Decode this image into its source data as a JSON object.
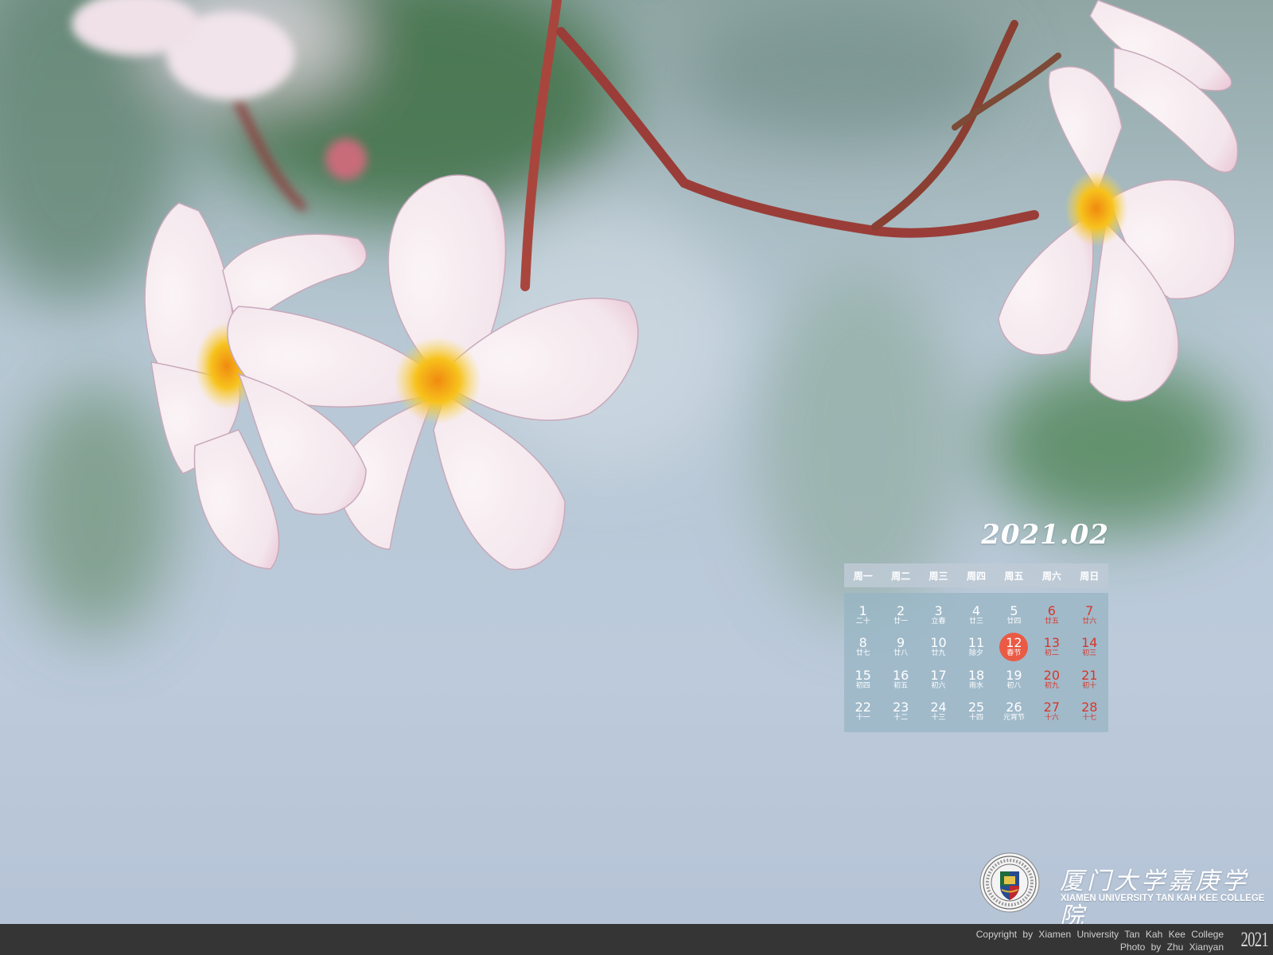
{
  "calendar": {
    "month_title": "2021.02",
    "weekdays": [
      "周一",
      "周二",
      "周三",
      "周四",
      "周五",
      "周六",
      "周日"
    ],
    "days": [
      {
        "d": "1",
        "l": "二十",
        "we": false
      },
      {
        "d": "2",
        "l": "廿一",
        "we": false
      },
      {
        "d": "3",
        "l": "立春",
        "we": false
      },
      {
        "d": "4",
        "l": "廿三",
        "we": false
      },
      {
        "d": "5",
        "l": "廿四",
        "we": false
      },
      {
        "d": "6",
        "l": "廿五",
        "we": true
      },
      {
        "d": "7",
        "l": "廿六",
        "we": true
      },
      {
        "d": "8",
        "l": "廿七",
        "we": false
      },
      {
        "d": "9",
        "l": "廿八",
        "we": false
      },
      {
        "d": "10",
        "l": "廿九",
        "we": false
      },
      {
        "d": "11",
        "l": "除夕",
        "we": false
      },
      {
        "d": "12",
        "l": "春节",
        "we": false,
        "today": true
      },
      {
        "d": "13",
        "l": "初二",
        "we": true
      },
      {
        "d": "14",
        "l": "初三",
        "we": true
      },
      {
        "d": "15",
        "l": "初四",
        "we": false
      },
      {
        "d": "16",
        "l": "初五",
        "we": false
      },
      {
        "d": "17",
        "l": "初六",
        "we": false
      },
      {
        "d": "18",
        "l": "雨水",
        "we": false
      },
      {
        "d": "19",
        "l": "初八",
        "we": false
      },
      {
        "d": "20",
        "l": "初九",
        "we": true
      },
      {
        "d": "21",
        "l": "初十",
        "we": true
      },
      {
        "d": "22",
        "l": "十一",
        "we": false
      },
      {
        "d": "23",
        "l": "十二",
        "we": false
      },
      {
        "d": "24",
        "l": "十三",
        "we": false
      },
      {
        "d": "25",
        "l": "十四",
        "we": false
      },
      {
        "d": "26",
        "l": "元宵节",
        "we": false
      },
      {
        "d": "27",
        "l": "十六",
        "we": true
      },
      {
        "d": "28",
        "l": "十七",
        "we": true
      }
    ]
  },
  "branding": {
    "cn_name": "厦门大学嘉庚学院",
    "en_name": "XIAMEN UNIVERSITY TAN KAH KEE COLLEGE"
  },
  "footer": {
    "copyright": "Copyright by Xiamen University Tan Kah Kee College",
    "photo_credit": "Photo by Zhu Xianyan",
    "year": "2021"
  },
  "colors": {
    "accent_red": "#d8362a",
    "today_circle": "#ea5a45",
    "footer_bg": "#353535"
  },
  "icons": [
    "college-seal-icon"
  ]
}
